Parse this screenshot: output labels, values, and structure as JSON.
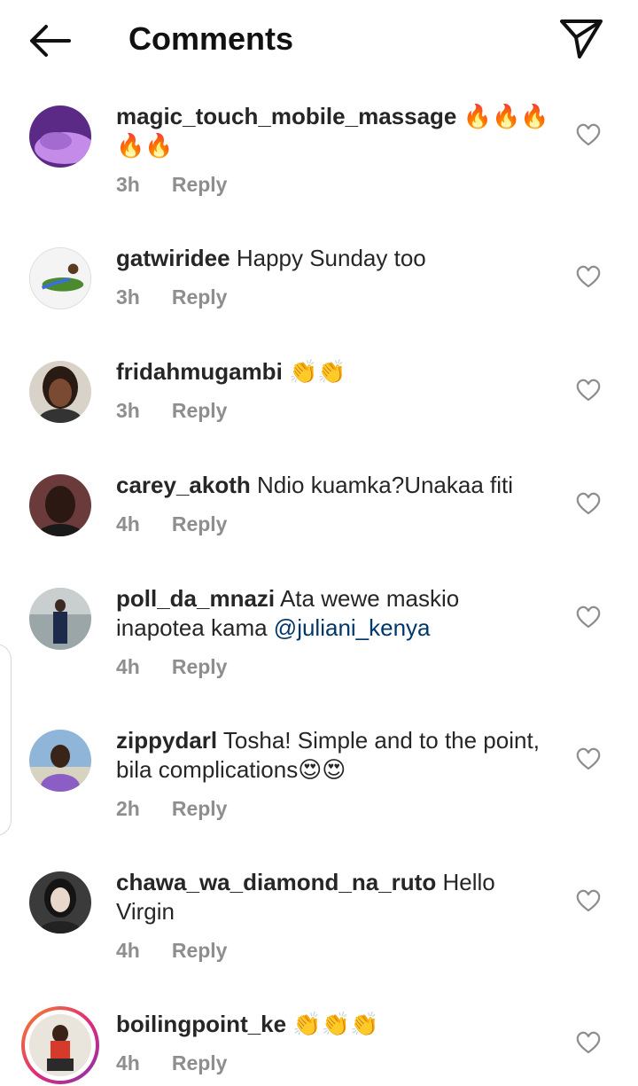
{
  "header": {
    "title": "Comments",
    "back_icon": "arrow-left-icon",
    "share_icon": "paper-plane-icon"
  },
  "comments": [
    {
      "username": "magic_touch_mobile_massage",
      "text": "🔥🔥🔥🔥🔥",
      "time": "3h",
      "reply": "Reply"
    },
    {
      "username": "gatwiridee",
      "text": "Happy Sunday too",
      "time": "3h",
      "reply": "Reply"
    },
    {
      "username": "fridahmugambi",
      "text": "👏👏",
      "time": "3h",
      "reply": "Reply"
    },
    {
      "username": "carey_akoth",
      "text": "Ndio kuamka?Unakaa fiti",
      "time": "4h",
      "reply": "Reply"
    },
    {
      "username": "poll_da_mnazi",
      "text": "Ata wewe maskio inapotea kama ",
      "mention": "@juliani_kenya",
      "time": "4h",
      "reply": "Reply"
    },
    {
      "username": "zippydarl",
      "text": "Tosha! Simple and to the point, bila complications😍😍",
      "time": "2h",
      "reply": "Reply"
    },
    {
      "username": "chawa_wa_diamond_na_ruto",
      "text": "Hello Virgin",
      "time": "4h",
      "reply": "Reply"
    },
    {
      "username": "boilingpoint_ke",
      "text": "👏👏👏",
      "time": "4h",
      "reply": "Reply"
    }
  ],
  "colors": {
    "text": "#262626",
    "meta": "#8e8e8e",
    "mention": "#00376b",
    "story_ring": [
      "#f58529",
      "#dd2a7b",
      "#8134af"
    ]
  }
}
